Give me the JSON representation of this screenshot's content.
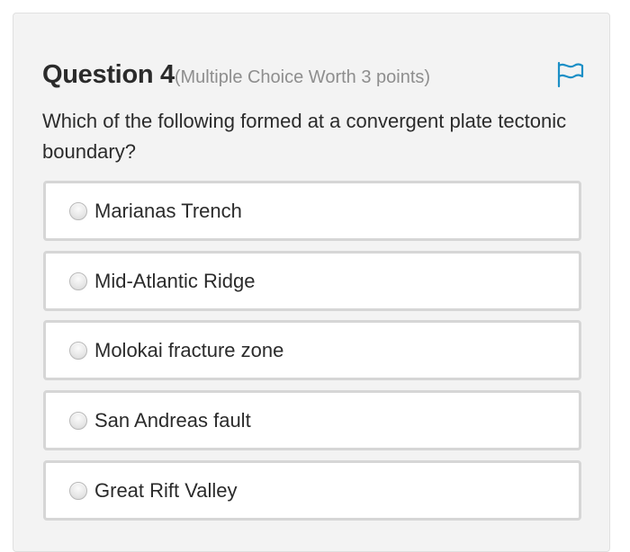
{
  "question": {
    "title": "Question 4",
    "meta": "(Multiple Choice Worth 3 points)",
    "text": "Which of the following formed at a convergent plate tectonic boundary?",
    "flag_icon": "flag-icon",
    "accent_color": "#1b8fc6"
  },
  "options": [
    {
      "label": "Marianas Trench",
      "selected": false
    },
    {
      "label": "Mid-Atlantic Ridge",
      "selected": false
    },
    {
      "label": "Molokai fracture zone",
      "selected": false
    },
    {
      "label": "San Andreas fault",
      "selected": false
    },
    {
      "label": "Great Rift Valley",
      "selected": false
    }
  ]
}
